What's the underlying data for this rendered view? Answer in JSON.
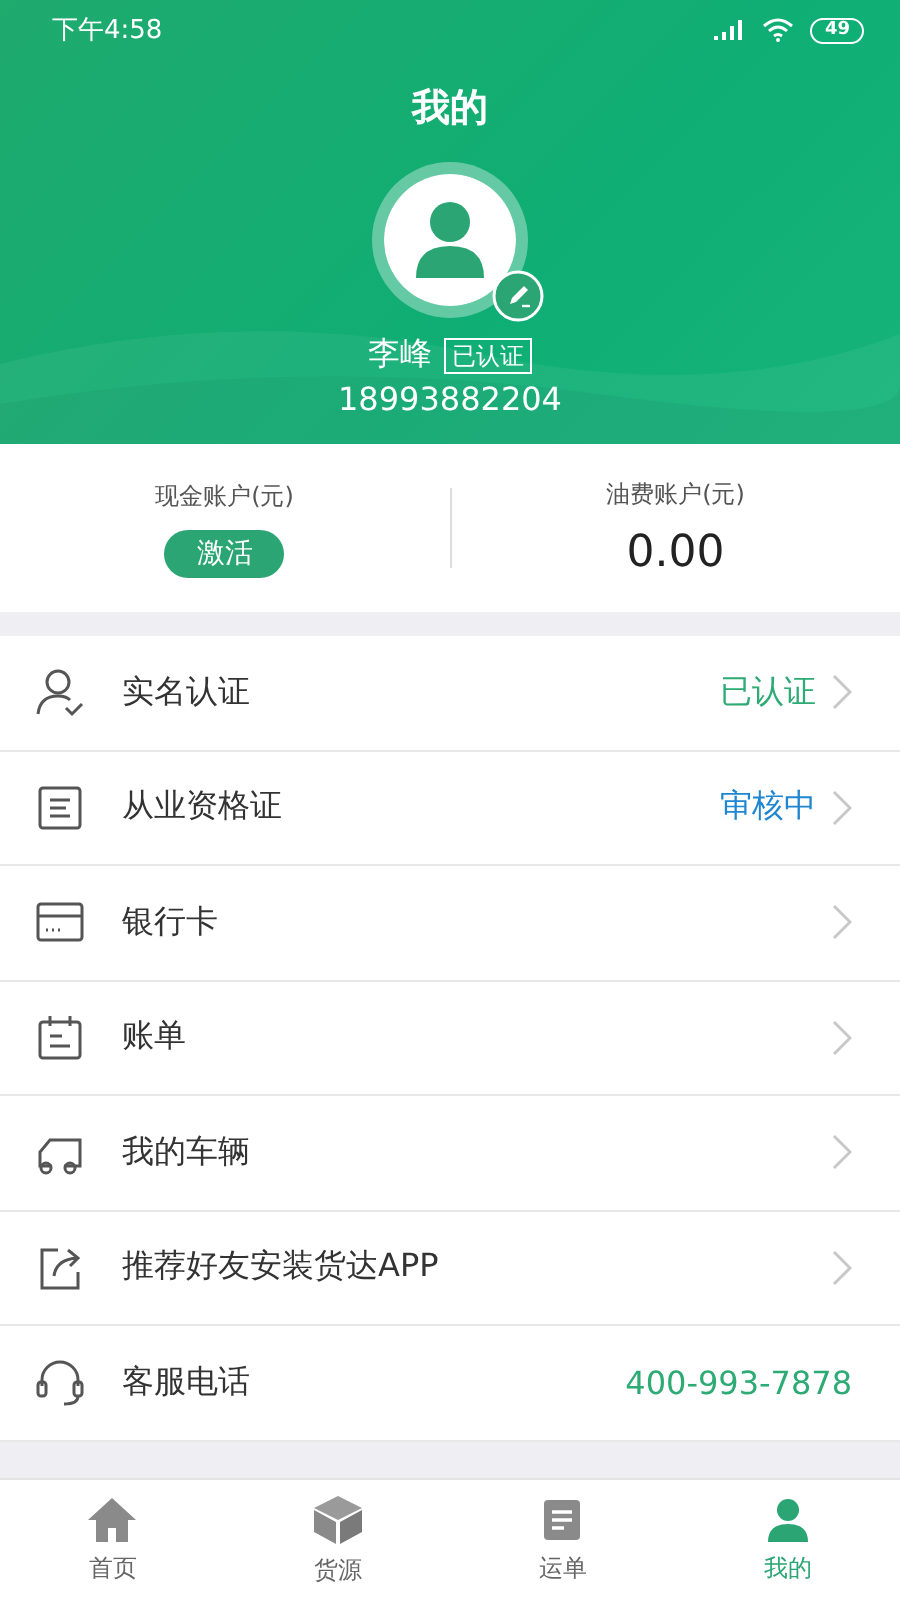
{
  "status_bar": {
    "time": "下午4:58",
    "battery": "49"
  },
  "header": {
    "title": "我的",
    "name": "李峰",
    "badge": "已认证",
    "phone": "18993882204"
  },
  "accounts": [
    {
      "label": "现金账户(元)",
      "kind": "button",
      "value": "激活"
    },
    {
      "label": "油费账户(元)",
      "kind": "amount",
      "value": "0.00"
    }
  ],
  "menu": [
    {
      "label": "实名认证",
      "status": {
        "text": "已认证",
        "color": "#2eaa74"
      },
      "chevron": true
    },
    {
      "label": "从业资格证",
      "status": {
        "text": "审核中",
        "color": "#1f86d0"
      },
      "chevron": true
    },
    {
      "label": "银行卡",
      "chevron": true
    },
    {
      "label": "账单",
      "chevron": true
    },
    {
      "label": "我的车辆",
      "chevron": true
    },
    {
      "label": "推荐好友安装货达APP",
      "chevron": true
    },
    {
      "label": "客服电话",
      "status": {
        "text": "400-993-7878",
        "color": "#2eaa74"
      },
      "chevron": false
    }
  ],
  "tabs": [
    {
      "label": "首页",
      "selected": false
    },
    {
      "label": "货源",
      "selected": false
    },
    {
      "label": "运单",
      "selected": false
    },
    {
      "label": "我的",
      "selected": true
    }
  ]
}
